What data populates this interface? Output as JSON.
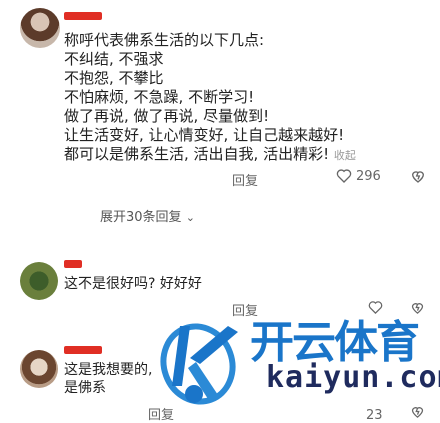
{
  "post": {
    "lines": [
      "称呼代表佛系生活的以下几点:",
      "不纠结, 不强求",
      "不抱怨, 不攀比",
      "不怕麻烦, 不急躁, 不断学习!",
      "做了再说, 做了再说, 尽量做到!",
      "让生活变好, 让心情变好, 让自己越来越好!",
      "都可以是佛系生活, 活出自我, 活出精彩!"
    ],
    "faded_tail": "收起",
    "time_label": "回复",
    "like_count": "296"
  },
  "expand_replies": "展开30条回复",
  "comments": [
    {
      "text": "这不是很好吗? 好好好",
      "time_label": "回复",
      "like_count": ""
    },
    {
      "text": "这是我想要的,",
      "text2": "是佛系",
      "time_label": "回复",
      "like_count": "23"
    }
  ],
  "watermark": {
    "brand_cn": "开云体育",
    "domain": "kaiyun.com"
  },
  "colors": {
    "red": "#e02e24",
    "blue": "#1a75c9",
    "gray": "#999999"
  }
}
